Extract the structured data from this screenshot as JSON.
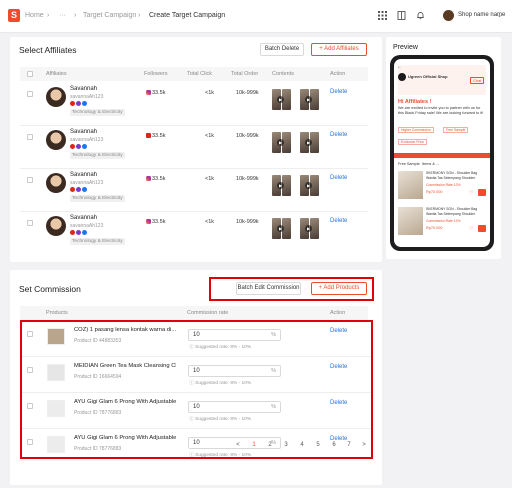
{
  "topbar": {
    "breadcrumb": [
      "Home",
      "···",
      "Target Campaign",
      "Create Target Campaign"
    ],
    "shop_name": "Shop name name"
  },
  "affiliates": {
    "title": "Select Affiliates",
    "batch_delete": "Batch Delete",
    "add_label": "Add Affiliates",
    "columns": [
      "Affiliates",
      "Followers",
      "Total Click",
      "Total Order",
      "Contents",
      "Action"
    ],
    "rows": [
      {
        "name": "Savannah",
        "handle": "savannaAh123",
        "followers": "33.5k",
        "platform": "instagram",
        "clicks": "<1k",
        "orders": "10k-999k",
        "category": "Technology & Electricity",
        "action": "Delete"
      },
      {
        "name": "Savannah",
        "handle": "savannaAh123",
        "followers": "33.5k",
        "platform": "youtube",
        "clicks": "<1k",
        "orders": "10k-999k",
        "category": "Technology & Electricity",
        "action": "Delete"
      },
      {
        "name": "Savannah",
        "handle": "savannaAh123",
        "followers": "33.5k",
        "platform": "instagram",
        "clicks": "<1k",
        "orders": "10k-999k",
        "category": "Technology & Electricity",
        "action": "Delete"
      },
      {
        "name": "Savannah",
        "handle": "savannaAh123",
        "followers": "33.5k",
        "platform": "instagram",
        "clicks": "<1k",
        "orders": "10k-999k",
        "category": "Technology & Electricity",
        "action": "Delete"
      }
    ]
  },
  "commission": {
    "title": "Set Commission",
    "batch_edit": "Batch Edit Commission",
    "add_label": "Add Products",
    "columns": [
      "Products",
      "Commission rate",
      "Action"
    ],
    "rows": [
      {
        "name": "COZ) 1 pasang lensa kontak warna di...",
        "pid": "Product ID 44883353",
        "rate": "10",
        "pct": "%",
        "hint": "Suggested rate: 8% - 10%",
        "action": "Delete"
      },
      {
        "name": "MEIDIAN Green Tea Mask Cleansing Cl...",
        "pid": "Product ID 16664594",
        "rate": "10",
        "pct": "%",
        "hint": "Suggested rate: 8% - 10%",
        "action": "Delete"
      },
      {
        "name": "AYU Gigi Glam 6 Prong With Adjustable...",
        "pid": "Product ID 78776883",
        "rate": "10",
        "pct": "%",
        "hint": "Suggested rate: 8% - 10%",
        "action": "Delete"
      },
      {
        "name": "AYU Gigi Glam 6 Prong With Adjustable...",
        "pid": "Product ID 78776883",
        "rate": "10",
        "pct": "%",
        "hint": "Suggested rate: 8% - 10%",
        "action": "Delete"
      }
    ],
    "pagination": [
      "<",
      "1",
      "2",
      "3",
      "4",
      "5",
      "6",
      "7",
      ">"
    ],
    "current_page": "1"
  },
  "preview": {
    "title": "Preview",
    "shop": "Ugreen Official Shop",
    "chat": "Chat",
    "greeting": "Hi Affiliates !",
    "invite": "We are excited to invite you to partner with us for this Black Friday sale! We are looking forward to it!",
    "perks": [
      "Higher Commission",
      "Free Sample",
      "Exclusive Price"
    ],
    "tabs": [
      "Free Sample",
      "Items & ..."
    ],
    "product_name": "SKERMONY SON - Shoulder Bag Wanita Tas Selempang Shoulder",
    "commission": "Commission Rate 12%",
    "price": "Rp70.000"
  },
  "colors": {
    "accent": "#ee4d2d",
    "link": "#2673dd",
    "highlight": "#e0000a"
  }
}
